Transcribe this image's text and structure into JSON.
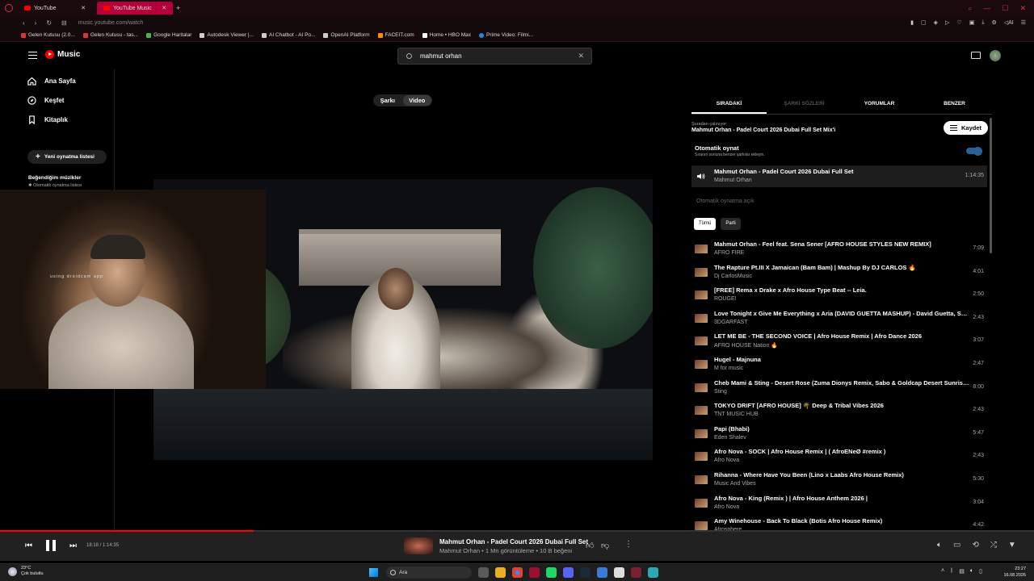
{
  "browser": {
    "tabs": [
      {
        "label": "YouTube",
        "active": false
      },
      {
        "label": "YouTube Music",
        "active": true
      }
    ],
    "new_tab": "+",
    "url": "music.youtube.com/watch",
    "bookmarks": [
      "Gelen Kutusu (2.0...",
      "Gelen Kutusu - tas...",
      "Google Haritalar",
      "Autodesk Viewer |...",
      "AI Chatbot - AI Po...",
      "OpenAI Platform",
      "FACEIT.com",
      "Home • HBO Max",
      "Prime Video: Filmi..."
    ],
    "accent": "#b3003b"
  },
  "header": {
    "logo_text": "Music",
    "search_value": "mahmut orhan",
    "clear_symbol": "✕"
  },
  "sidebar": {
    "items": [
      {
        "label": "Ana Sayfa",
        "icon": "home-icon"
      },
      {
        "label": "Keşfet",
        "icon": "compass-icon"
      },
      {
        "label": "Kitaplık",
        "icon": "library-icon"
      }
    ],
    "new_playlist": "Yeni oynatma listesi",
    "liked_title": "Beğendiğim müzikler",
    "liked_sub": "Otomatik oynatma listesi"
  },
  "main": {
    "toggle": {
      "song": "Şarkı",
      "video": "Video",
      "selected": "video"
    },
    "webcam_watermark": "using droidcam app"
  },
  "panel": {
    "tabs": [
      {
        "label": "SIRADAKİ",
        "state": "active"
      },
      {
        "label": "ŞARKI SÖZLERİ",
        "state": "disabled"
      },
      {
        "label": "YORUMLAR",
        "state": "normal"
      },
      {
        "label": "BENZER",
        "state": "normal"
      }
    ],
    "playing_from_label": "Şuradan çalınıyor:",
    "playing_from_title": "Mahmut Orhan - Padel Court 2026 Dubai Full Set Mix'i",
    "save_label": "Kaydet",
    "autoplay_title": "Otomatik oynat",
    "autoplay_sub": "Sıranın sonuna benzer şarkılar ekleyin.",
    "autoplay_on": true,
    "now_playing": {
      "title": "Mahmut Orhan - Padel Court 2026 Dubai Full Set",
      "artist": "Mahmut Orhan",
      "duration": "1:14:35"
    },
    "autoplay_status": "Otomatik oynatma açık",
    "chips": [
      {
        "label": "Tümü",
        "selected": true
      },
      {
        "label": "Parti",
        "selected": false
      }
    ],
    "queue": [
      {
        "title": "Mahmut Orhan - Feel feat. Sena Sener [AFRO HOUSE STYLES NEW REMIX]",
        "artist": "AFRO FIRE",
        "duration": "7:09"
      },
      {
        "title": "The Rapture Pt.III X Jamaican (Bam Bam) | Mashup By DJ CARLOS 🔥",
        "artist": "Dj CarlosMusic",
        "duration": "4:01"
      },
      {
        "title": "[FREE] Rema x Drake x Afro House Type Beat -- Leia.",
        "artist": "ROUGE!",
        "duration": "2:50"
      },
      {
        "title": "Love Tonight x Give Me Everything x Aria (DAVID GUETTA MASHUP) - David Guetta, Sh...",
        "artist": "3DGARFAST",
        "duration": "2:43"
      },
      {
        "title": "LET ME BE - THE SECOND VOICE | Afro House Remix | Afro Dance 2026",
        "artist": "AFRO HOUSE Nation 🔥",
        "duration": "3:07"
      },
      {
        "title": "Hugel - Majnuna",
        "artist": "M for music",
        "duration": "2:47"
      },
      {
        "title": "Cheb Mami & Sting - Desert Rose (Zuma Dionys Remix, Sabo & Goldcap Desert Sunrise...",
        "artist": "Sting",
        "duration": "8:00"
      },
      {
        "title": "TOKYO DRIFT [AFRO HOUSE] 🌴 Deep & Tribal Vibes 2026",
        "artist": "TNT MUSIC HUB",
        "duration": "2:43"
      },
      {
        "title": "Papi (Bhabi)",
        "artist": "Eden Shalev",
        "duration": "5:47"
      },
      {
        "title": "Afro Nova - SOCK | Afro House Remix | ( AfroENeØ #remix )",
        "artist": "Afro Nova",
        "duration": "2:43"
      },
      {
        "title": "Rihanna - Where Have You Been (Lino x Laabs Afro House Remix)",
        "artist": "Music And Vibes",
        "duration": "5:30"
      },
      {
        "title": "Afro Nova - King (Remix ) | Afro House Anthem 2026 |",
        "artist": "Afro Nova",
        "duration": "3:04"
      },
      {
        "title": "Amy Winehouse - Back To Black (Botis Afro House Remix)",
        "artist": "Afrosphere",
        "duration": "4:42"
      }
    ]
  },
  "player": {
    "time": "18:18 / 1:14:35",
    "progress_fraction": 0.245,
    "title": "Mahmut Orhan - Padel Court 2026 Dubai Full Set",
    "meta": "Mahmut Orhan • 1 Mn görüntüleme • 10 B beğeni"
  },
  "taskbar": {
    "weather_temp": "23°C",
    "weather_desc": "Çok bulutlu",
    "search_label": "Ara",
    "time": "23:27",
    "date": "16.08.2026"
  }
}
